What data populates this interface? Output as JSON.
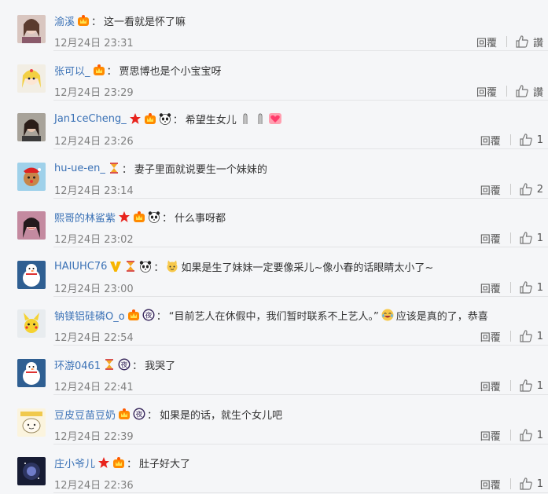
{
  "reply_label": "回覆",
  "comments": [
    {
      "user": "渝溪",
      "badges": [
        "vip-crown"
      ],
      "text": "这一看就是怀了嘛",
      "time": "12月24日 23:31",
      "like": "讚"
    },
    {
      "user": "张可以_",
      "badges": [
        "vip-crown"
      ],
      "text": "贾思博也是个小宝宝呀",
      "time": "12月24日 23:29",
      "like": "讚"
    },
    {
      "user": "Jan1ceCheng_",
      "badges": [
        "star",
        "vip-crown",
        "panda"
      ],
      "text": "希望生女儿",
      "emoji_tail": [
        "pray",
        "pray",
        "heart"
      ],
      "time": "12月24日 23:26",
      "like": "1"
    },
    {
      "user": "hu-ue-en_",
      "badges": [
        "hourglass"
      ],
      "text": "妻子里面就说要生一个妹妹的",
      "time": "12月24日 23:14",
      "like": "2"
    },
    {
      "user": "熙哥的林鲨紫",
      "badges": [
        "star",
        "vip-crown",
        "panda"
      ],
      "text": "什么事呀都",
      "time": "12月24日 23:02",
      "like": "1"
    },
    {
      "user": "HAIUHC76",
      "badges": [
        "v-badge",
        "hourglass",
        "panda"
      ],
      "emoji_head": "cat",
      "text": "如果是生了妹妹一定要像采儿~像小春的话眼睛太小了~",
      "time": "12月24日 23:00",
      "like": "1"
    },
    {
      "user": "钠镁铝硅磷O_o",
      "badges": [
        "vip-crown",
        "night"
      ],
      "text": "“目前艺人在休假中，我们暂时联系不上艺人。”",
      "emoji_after": "laugh-cry",
      "text_tail": "应该是真的了，恭喜",
      "time": "12月24日 22:54",
      "like": "1"
    },
    {
      "user": "环游0461",
      "badges": [
        "hourglass",
        "night"
      ],
      "text": "我哭了",
      "time": "12月24日 22:41",
      "like": "1"
    },
    {
      "user": "豆皮豆苗豆奶",
      "badges": [
        "vip-crown",
        "night"
      ],
      "text": "如果是的话，就生个女儿吧",
      "time": "12月24日 22:39",
      "like": "1"
    },
    {
      "user": "庄小爷儿",
      "badges": [
        "star",
        "vip-crown"
      ],
      "text": "肚子好大了",
      "time": "12月24日 22:36",
      "like": "1"
    }
  ]
}
